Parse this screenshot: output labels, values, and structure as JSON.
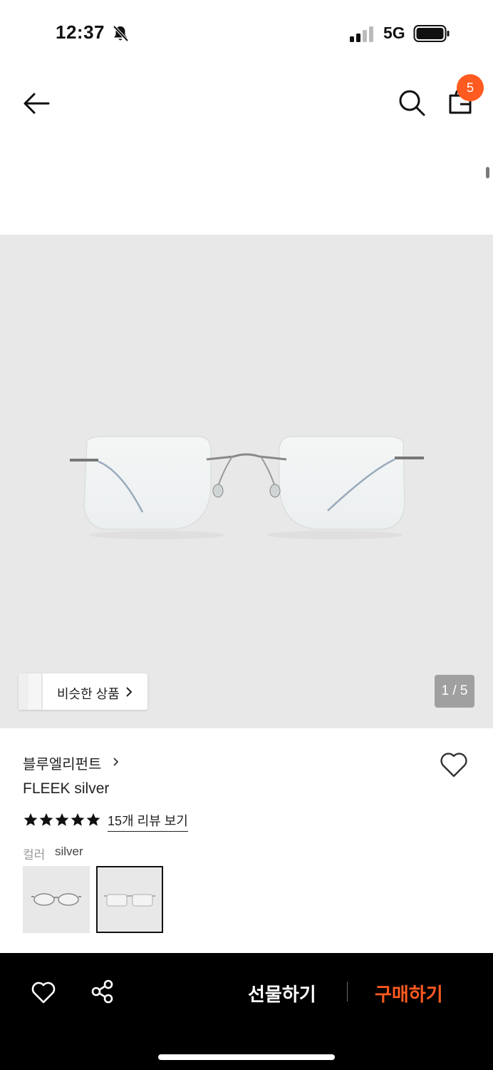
{
  "status_bar": {
    "time": "12:37",
    "network": "5G"
  },
  "header": {
    "cart_count": "5"
  },
  "hero": {
    "similar_label": "비슷한 상품",
    "pager": "1 / 5",
    "background": "#e8e8e8"
  },
  "product": {
    "brand": "블루엘리펀트",
    "name": "FLEEK silver",
    "rating": 5,
    "review_link": "15개 리뷰 보기",
    "color_label": "컬러",
    "color_value": "silver",
    "swatches": [
      {
        "name": "variant-1",
        "selected": false
      },
      {
        "name": "silver",
        "selected": true
      }
    ]
  },
  "bottom_bar": {
    "gift_label": "선물하기",
    "buy_label": "구매하기",
    "accent": "#ff5a1f"
  }
}
